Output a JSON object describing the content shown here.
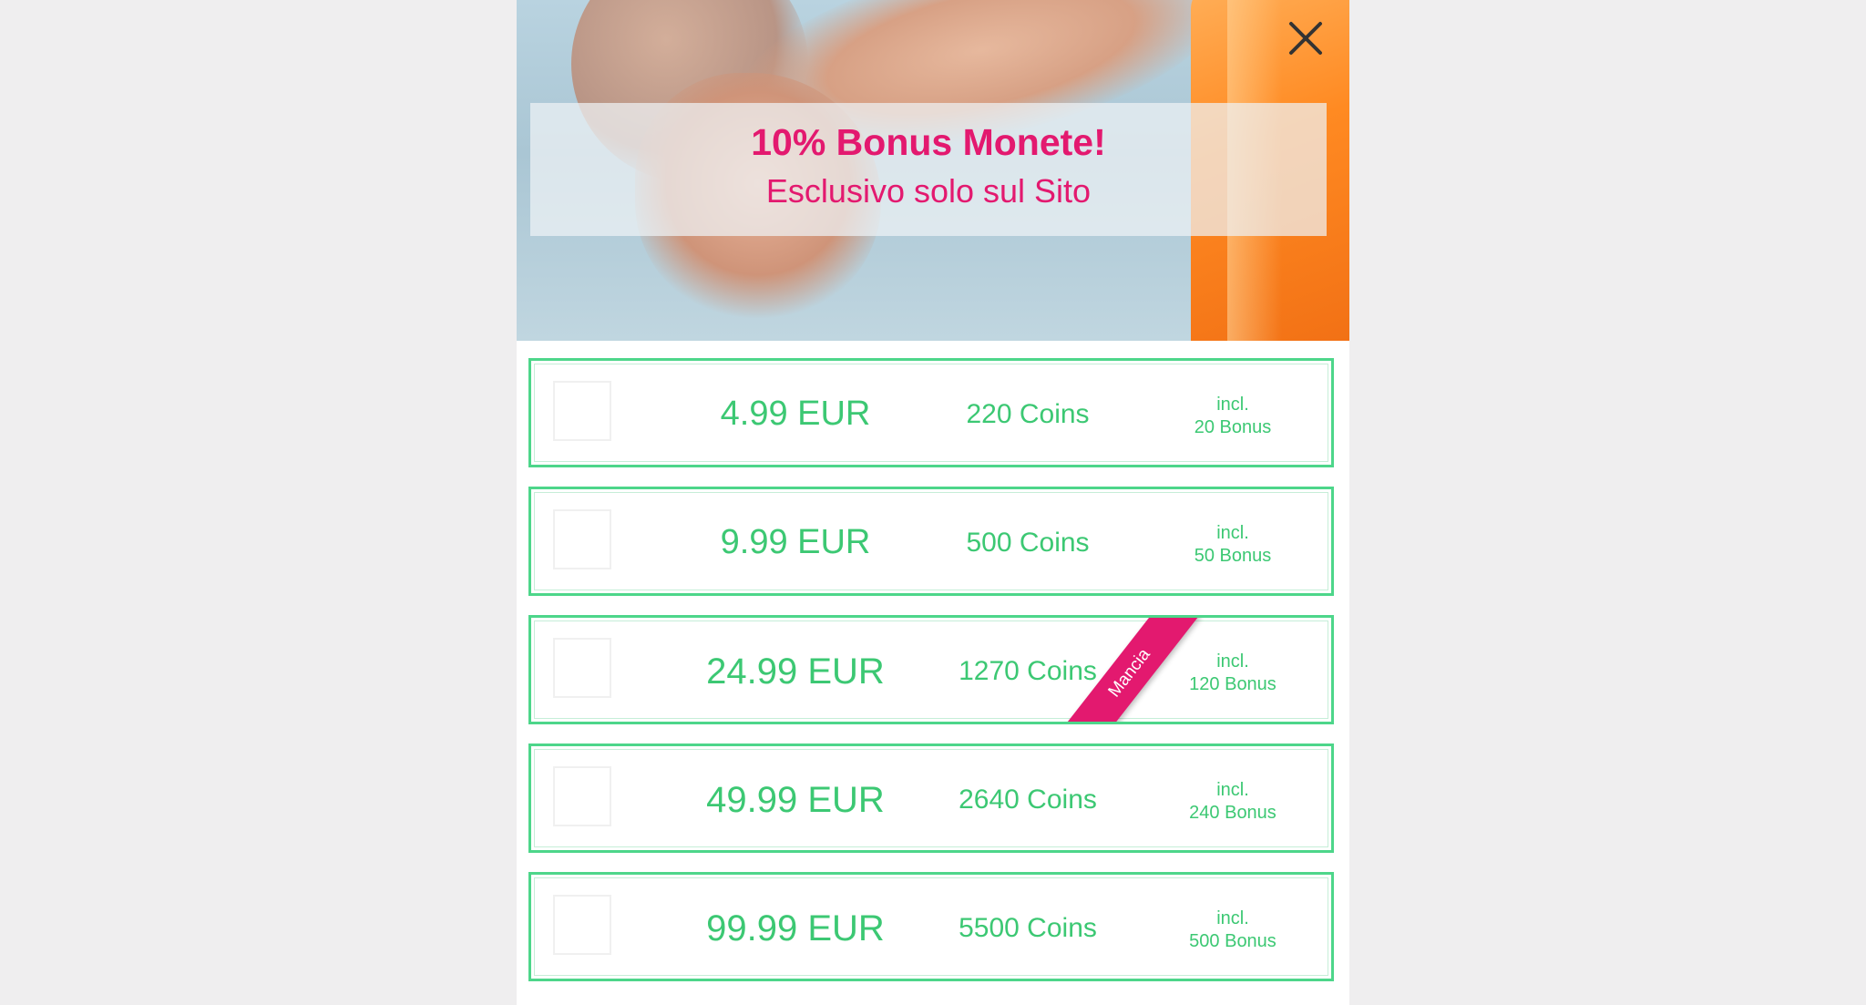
{
  "promo": {
    "title": "10% Bonus Monete!",
    "subtitle": "Esclusivo solo sul Sito"
  },
  "colors": {
    "accent_pink": "#e3196f",
    "offer_green": "#3cc873",
    "border_green": "#4dd68a",
    "page_background": "#efeeef"
  },
  "offers": [
    {
      "price": "4.99 EUR",
      "coins": "220 Coins",
      "bonus_prefix": "incl.",
      "bonus": "20 Bonus"
    },
    {
      "price": "9.99 EUR",
      "coins": "500 Coins",
      "bonus_prefix": "incl.",
      "bonus": "50 Bonus"
    },
    {
      "price": "24.99 EUR",
      "coins": "1270 Coins",
      "bonus_prefix": "incl.",
      "bonus": "120 Bonus",
      "ribbon": "Mancia"
    },
    {
      "price": "49.99 EUR",
      "coins": "2640 Coins",
      "bonus_prefix": "incl.",
      "bonus": "240 Bonus"
    },
    {
      "price": "99.99 EUR",
      "coins": "5500 Coins",
      "bonus_prefix": "incl.",
      "bonus": "500 Bonus"
    }
  ],
  "icons": {
    "close": "close-icon",
    "checkbox": "checkbox-icon"
  }
}
